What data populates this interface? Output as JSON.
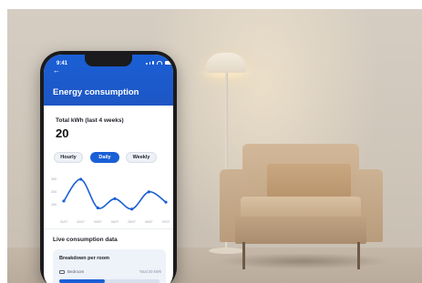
{
  "app": {
    "status_time": "9:41",
    "title": "Energy consumption"
  },
  "total": {
    "label": "Total kWh (last 4 weeks)",
    "value": "20"
  },
  "tabs": [
    {
      "label": "Hourly",
      "selected": false
    },
    {
      "label": "Daily",
      "selected": true
    },
    {
      "label": "Weekly",
      "selected": false
    }
  ],
  "chart_data": {
    "type": "line",
    "title": "",
    "xlabel": "",
    "ylabel": "",
    "x": [
      "01/07",
      "02/07",
      "03/07",
      "04/07",
      "05/07",
      "06/07",
      "07/07"
    ],
    "series": [
      {
        "values": [
          1.2,
          3.1,
          0.6,
          1.4,
          0.5,
          2.0,
          1.1
        ]
      }
    ],
    "ylim": [
      0,
      3.5
    ],
    "ytick_labels": [
      "300",
      "200",
      "100"
    ],
    "grid": false,
    "accent_color": "#1a5fd6"
  },
  "live": {
    "section_title": "Live consumption data",
    "breakdown_title": "Breakdown per room",
    "room_name": "Bedroom",
    "room_total": "Total 20 kWh",
    "room_share": 0.45
  },
  "colors": {
    "brand_blue": "#1a5fd6",
    "wall": "#d5cdc2",
    "armchair": "#c9a780"
  },
  "icons": {
    "back": "back-arrow-icon",
    "signal": "signal-icon",
    "wifi": "wifi-icon",
    "battery": "battery-icon",
    "room": "bed-icon"
  }
}
